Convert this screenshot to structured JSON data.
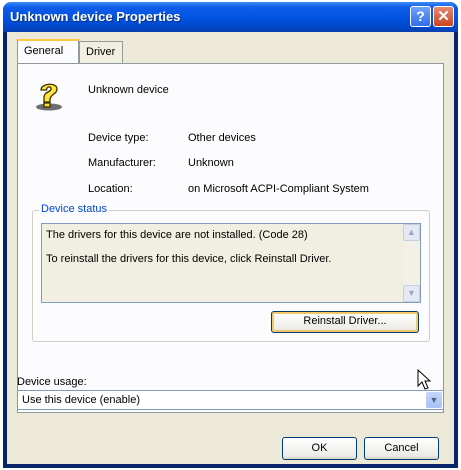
{
  "window": {
    "title": "Unknown device Properties",
    "help_glyph": "?",
    "close_glyph": "✕"
  },
  "tabs": [
    {
      "label": "General"
    },
    {
      "label": "Driver"
    }
  ],
  "device": {
    "name": "Unknown device",
    "icon": "unknown-device-question-icon",
    "properties": [
      {
        "label": "Device type:",
        "value": "Other devices"
      },
      {
        "label": "Manufacturer:",
        "value": "Unknown"
      },
      {
        "label": "Location:",
        "value": "on Microsoft ACPI-Compliant System"
      }
    ]
  },
  "device_status": {
    "title": "Device status",
    "lines": [
      "The drivers for this device are not installed. (Code 28)",
      "To reinstall the drivers for this device, click Reinstall Driver."
    ],
    "button_label": "Reinstall Driver..."
  },
  "device_usage": {
    "label": "Device usage:",
    "selected": "Use this device (enable)"
  },
  "footer": {
    "ok_label": "OK",
    "cancel_label": "Cancel"
  },
  "colors": {
    "titlebar": "#0053e0",
    "dialog_face": "#ece9d8",
    "group_title": "#0046d5"
  }
}
